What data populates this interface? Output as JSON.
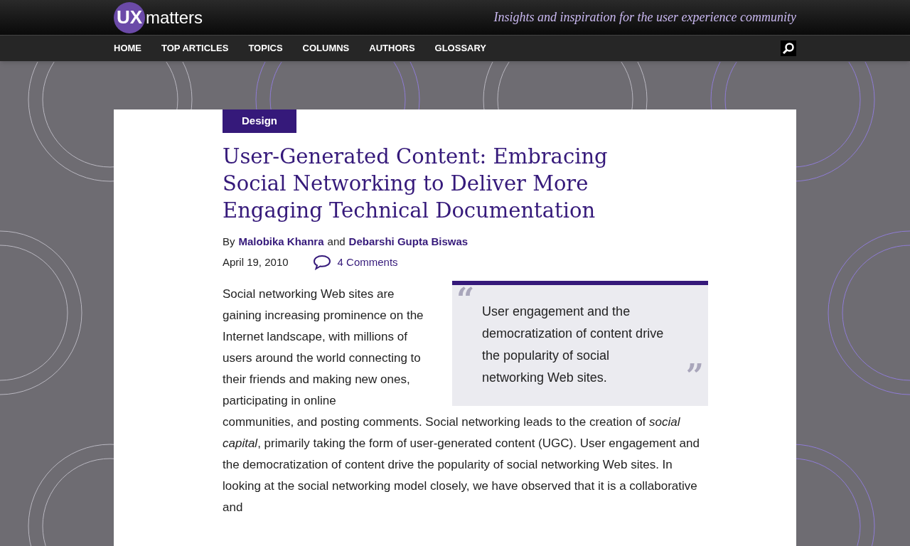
{
  "header": {
    "logo_mark": "UX",
    "logo_text": "matters",
    "tagline": "Insights and inspiration for the user experience community"
  },
  "nav": {
    "items": [
      "HOME",
      "TOP ARTICLES",
      "TOPICS",
      "COLUMNS",
      "AUTHORS",
      "GLOSSARY"
    ]
  },
  "article": {
    "category": "Design",
    "title": "User-Generated Content: Embracing Social Networking to Deliver More Engaging Technical Documentation",
    "byline": {
      "prefix": "By",
      "authors": [
        "Malobika Khanra",
        "Debarshi Gupta Biswas"
      ],
      "joiner": "and"
    },
    "date": "April 19, 2010",
    "comments": "4 Comments",
    "pullquote": {
      "open_mark": "“",
      "text": "User engagement and the democratization of content drive the popularity of social networking Web sites.",
      "close_mark": "”"
    },
    "body": [
      "Social networking Web sites are gaining increasing prominence on the Internet landscape, with millions of users around the world connecting to their friends and making new ones, participating in online",
      "communities, and posting comments. Social networking leads to the creation of *social capital*, primarily taking the form of user-generated content (UGC). User engagement and the democratization of content drive the popularity of social networking Web sites. In looking at the social networking model closely, we have observed that it is a collaborative and"
    ]
  }
}
